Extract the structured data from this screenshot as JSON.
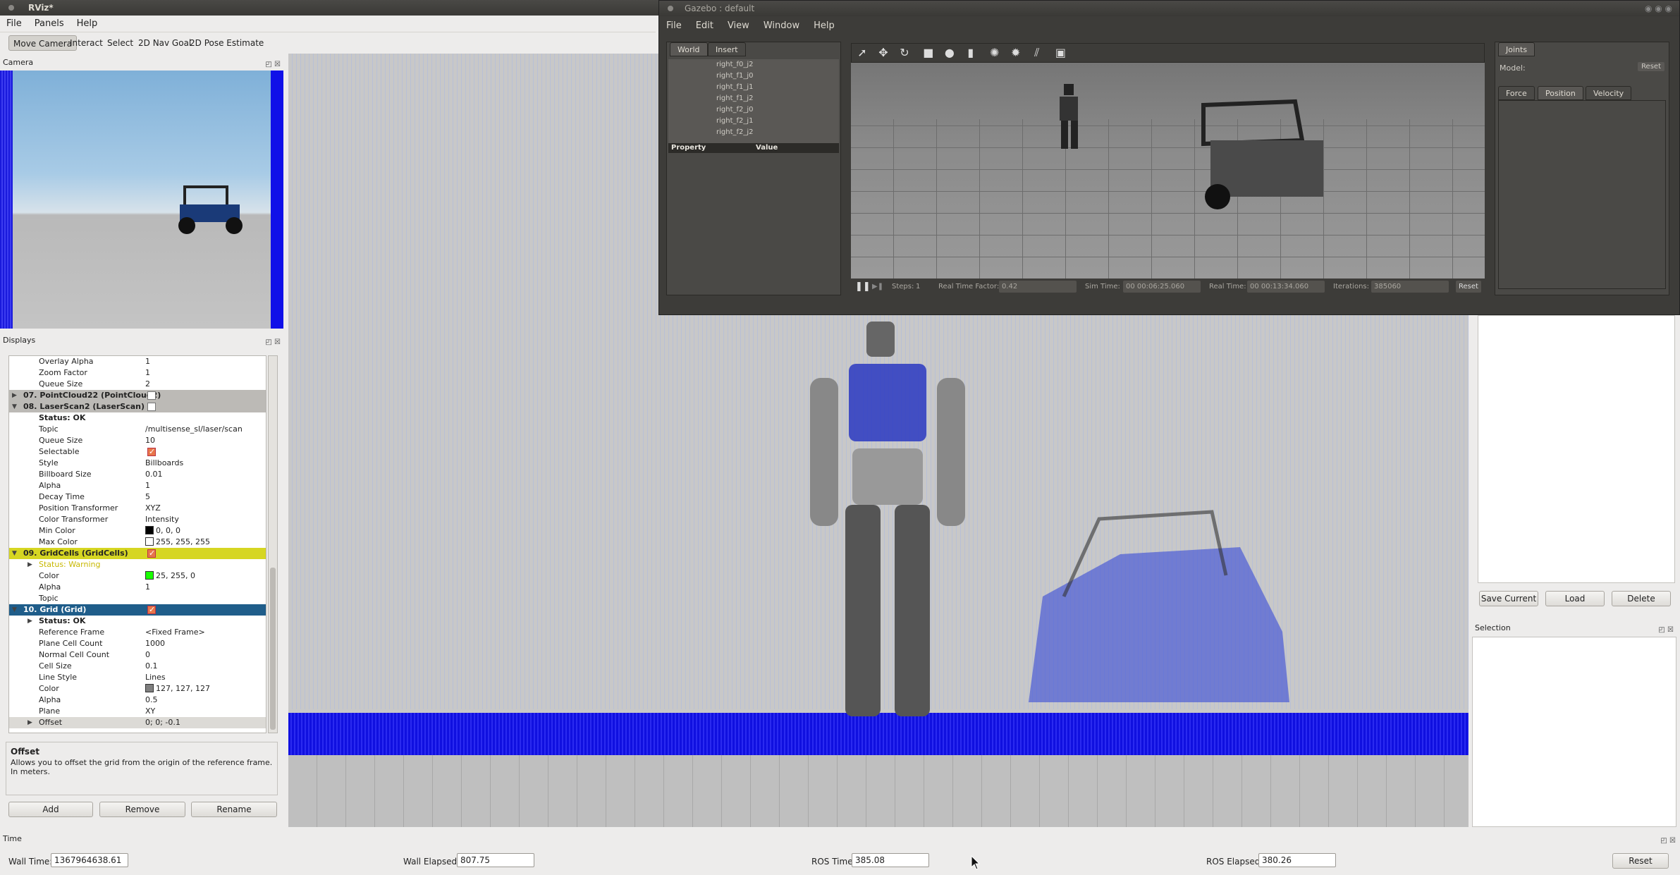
{
  "rviz": {
    "title": "RViz*",
    "menu": [
      "File",
      "Panels",
      "Help"
    ],
    "tools": [
      "Move Camera",
      "Interact",
      "Select",
      "2D Nav Goal",
      "2D Pose Estimate"
    ],
    "active_tool": "Move Camera",
    "camera_panel_title": "Camera",
    "displays_panel_title": "Displays",
    "displays": [
      {
        "kind": "prop",
        "key": "Overlay Alpha",
        "value": "1"
      },
      {
        "kind": "prop",
        "key": "Zoom Factor",
        "value": "1"
      },
      {
        "kind": "prop",
        "key": "Queue Size",
        "value": "2"
      },
      {
        "kind": "cat",
        "style": "grey",
        "arrow": "▶",
        "key": "07. PointCloud22 (PointCloud2)",
        "check": "off"
      },
      {
        "kind": "cat",
        "style": "grey",
        "arrow": "▼",
        "key": "08. LaserScan2 (LaserScan)",
        "check": "off"
      },
      {
        "kind": "prop",
        "key": "Status: OK",
        "value": "",
        "bold": true
      },
      {
        "kind": "prop",
        "key": "Topic",
        "value": "/multisense_sl/laser/scan"
      },
      {
        "kind": "prop",
        "key": "Queue Size",
        "value": "10"
      },
      {
        "kind": "prop",
        "key": "Selectable",
        "check": "on"
      },
      {
        "kind": "prop",
        "key": "Style",
        "value": "Billboards"
      },
      {
        "kind": "prop",
        "key": "Billboard Size",
        "value": "0.01"
      },
      {
        "kind": "prop",
        "key": "Alpha",
        "value": "1"
      },
      {
        "kind": "prop",
        "key": "Decay Time",
        "value": "5"
      },
      {
        "kind": "prop",
        "key": "Position Transformer",
        "value": "XYZ"
      },
      {
        "kind": "prop",
        "key": "Color Transformer",
        "value": "Intensity"
      },
      {
        "kind": "prop",
        "key": "Min Color",
        "value": "0, 0, 0",
        "swatch": "#000000"
      },
      {
        "kind": "prop",
        "key": "Max Color",
        "value": "255, 255, 255",
        "swatch": "#ffffff"
      },
      {
        "kind": "cat",
        "style": "yellow",
        "arrow": "▼",
        "key": "09. GridCells (GridCells)",
        "check": "on"
      },
      {
        "kind": "prop",
        "key": "Status: Warning",
        "value": "",
        "warn": true,
        "arrow": "▶"
      },
      {
        "kind": "prop",
        "key": "Color",
        "value": "25, 255, 0",
        "swatch": "#19ff00"
      },
      {
        "kind": "prop",
        "key": "Alpha",
        "value": "1"
      },
      {
        "kind": "prop",
        "key": "Topic",
        "value": ""
      },
      {
        "kind": "cat",
        "style": "blue",
        "arrow": "▼",
        "key": "10. Grid (Grid)",
        "check": "on"
      },
      {
        "kind": "prop",
        "key": "Status: OK",
        "value": "",
        "bold": true,
        "arrow": "▶"
      },
      {
        "kind": "prop",
        "key": "Reference Frame",
        "value": "<Fixed Frame>"
      },
      {
        "kind": "prop",
        "key": "Plane Cell Count",
        "value": "1000"
      },
      {
        "kind": "prop",
        "key": "Normal Cell Count",
        "value": "0"
      },
      {
        "kind": "prop",
        "key": "Cell Size",
        "value": "0.1"
      },
      {
        "kind": "prop",
        "key": "Line Style",
        "value": "Lines"
      },
      {
        "kind": "prop",
        "key": "Color",
        "value": "127, 127, 127",
        "swatch": "#7f7f7f"
      },
      {
        "kind": "prop",
        "key": "Alpha",
        "value": "0.5"
      },
      {
        "kind": "prop",
        "key": "Plane",
        "value": "XY"
      },
      {
        "kind": "prop",
        "key": "Offset",
        "value": "0; 0; -0.1",
        "arrow": "▶",
        "sel": true
      }
    ],
    "help_title": "Offset",
    "help_text": "Allows you to offset the grid from the origin of the reference frame. In meters.",
    "buttons": {
      "add": "Add",
      "remove": "Remove",
      "rename": "Rename"
    },
    "views_buttons": {
      "save": "Save Current",
      "load": "Load",
      "delete": "Delete"
    },
    "selection_title": "Selection",
    "time_panel_title": "Time",
    "time": {
      "wall_time_label": "Wall Time:",
      "wall_time": "1367964638.61",
      "wall_elapsed_label": "Wall Elapsed:",
      "wall_elapsed": "807.75",
      "ros_time_label": "ROS Time:",
      "ros_time": "385.08",
      "ros_elapsed_label": "ROS Elapsed:",
      "ros_elapsed": "380.26",
      "reset": "Reset"
    }
  },
  "gazebo": {
    "title": "Gazebo : default",
    "menu": [
      "File",
      "Edit",
      "View",
      "Window",
      "Help"
    ],
    "tabs": [
      "World",
      "Insert"
    ],
    "joint_list": [
      "right_f0_j2",
      "right_f1_j0",
      "right_f1_j1",
      "right_f1_j2",
      "right_f2_j0",
      "right_f2_j1",
      "right_f2_j2"
    ],
    "property_header": "Property",
    "value_header": "Value",
    "status": {
      "steps_label": "Steps:",
      "steps": "1",
      "rtf_label": "Real Time Factor:",
      "rtf": "0.42",
      "sim_label": "Sim Time:",
      "sim": "00 00:06:25.060",
      "real_label": "Real Time:",
      "real": "00 00:13:34.060",
      "iter_label": "Iterations:",
      "iter": "385060",
      "reset": "Reset"
    },
    "joints_tab": "Joints",
    "model_label": "Model:",
    "model_reset": "Reset",
    "joint_tabs": [
      "Force",
      "Position",
      "Velocity"
    ]
  }
}
